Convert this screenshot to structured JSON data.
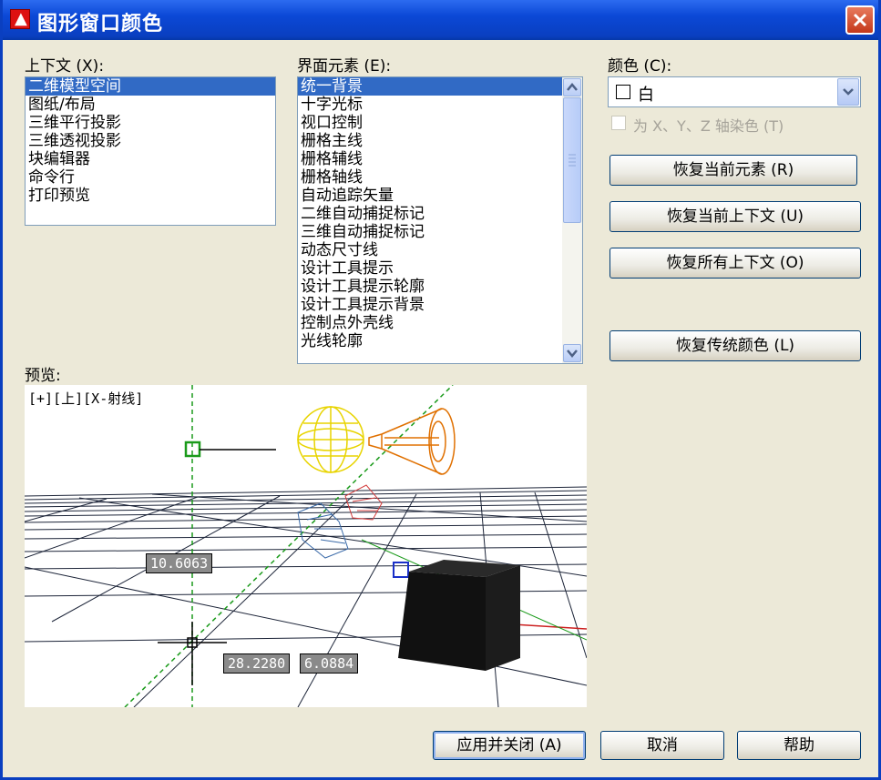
{
  "window": {
    "title": "图形窗口颜色"
  },
  "context": {
    "label": "上下文 (X):",
    "items": [
      "二维模型空间",
      "图纸/布局",
      "三维平行投影",
      "三维透视投影",
      "块编辑器",
      "命令行",
      "打印预览"
    ],
    "selected": 0
  },
  "interface": {
    "label": "界面元素 (E):",
    "items": [
      "统一背景",
      "十字光标",
      "视口控制",
      "栅格主线",
      "栅格辅线",
      "栅格轴线",
      "自动追踪矢量",
      "二维自动捕捉标记",
      "三维自动捕捉标记",
      "动态尺寸线",
      "设计工具提示",
      "设计工具提示轮廓",
      "设计工具提示背景",
      "控制点外壳线",
      "光线轮廓"
    ],
    "selected": 0
  },
  "color": {
    "label": "颜色 (C):",
    "value": "白",
    "checkbox_label": "为 X、Y、Z 轴染色 (T)"
  },
  "buttons": {
    "restore_element": "恢复当前元素 (R)",
    "restore_context": "恢复当前上下文 (U)",
    "restore_all": "恢复所有上下文 (O)",
    "restore_classic": "恢复传统颜色 (L)",
    "apply_close": "应用并关闭 (A)",
    "cancel": "取消",
    "help": "帮助"
  },
  "preview": {
    "label": "预览:",
    "viewport_label": "[+][上][X-射线]",
    "dim1": "10.6063",
    "dim2": "28.2280",
    "dim3": "6.0884"
  },
  "colors": {
    "selection": "#316ac5",
    "dialog_bg": "#ece9d8",
    "title_bar": "#0b48d6"
  }
}
